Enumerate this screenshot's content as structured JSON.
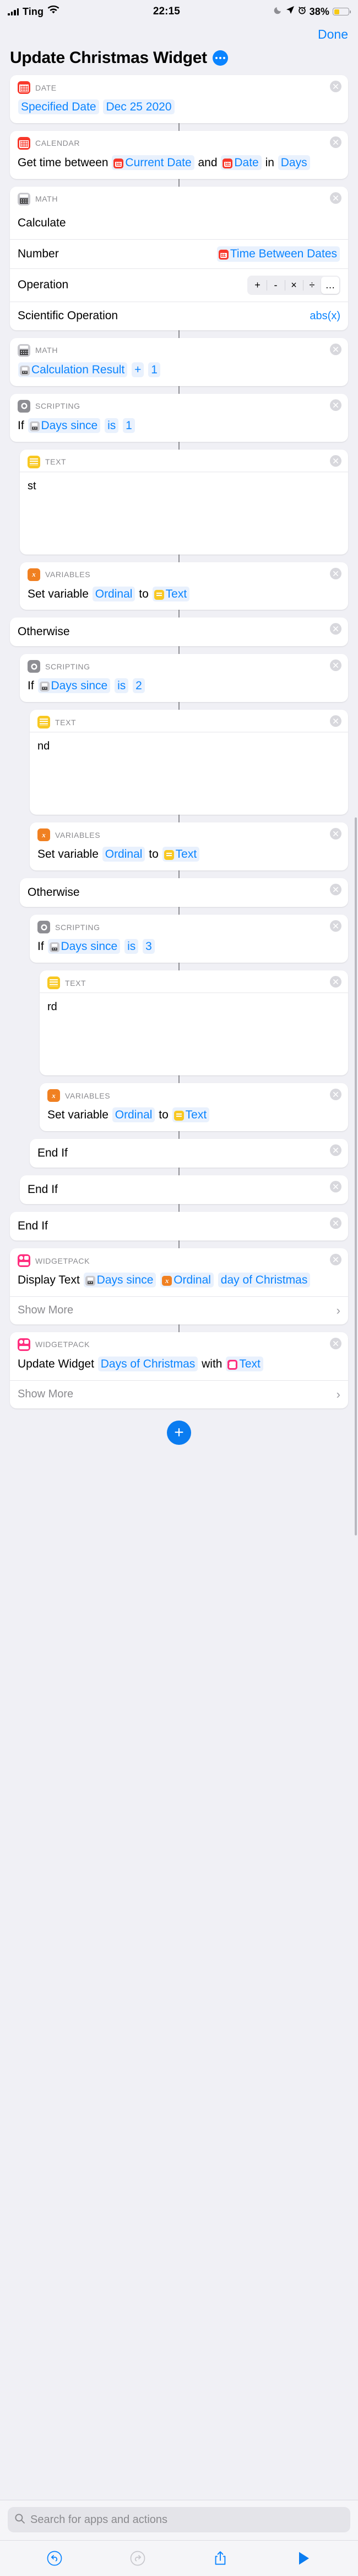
{
  "status_bar": {
    "carrier": "Ting",
    "time": "22:15",
    "battery_percent": "38%",
    "icons": [
      "signal-bars-icon",
      "wifi-icon",
      "moon-icon",
      "location-arrow-icon",
      "alarm-icon",
      "battery-icon"
    ]
  },
  "nav": {
    "done_label": "Done"
  },
  "header": {
    "title": "Update Christmas Widget",
    "more_label": "…"
  },
  "actions": [
    {
      "id": "date",
      "category": "DATE",
      "icon": "calendar-icon",
      "level": 0,
      "tokens": [
        {
          "t": "pill",
          "v": "Specified Date"
        },
        {
          "t": "pill",
          "v": "Dec 25 2020"
        }
      ]
    },
    {
      "id": "calendar",
      "category": "CALENDAR",
      "icon": "calendar-icon",
      "level": 0,
      "tokens": [
        {
          "t": "word",
          "v": "Get time between"
        },
        {
          "t": "pill-icon",
          "v": "Current Date",
          "icon": "calendar-icon"
        },
        {
          "t": "word",
          "v": "and"
        },
        {
          "t": "pill-icon",
          "v": "Date",
          "icon": "calendar-icon"
        },
        {
          "t": "word",
          "v": "in"
        },
        {
          "t": "pill",
          "v": "Days"
        }
      ]
    },
    {
      "id": "math-calculate",
      "category": "MATH",
      "icon": "calculator-icon",
      "level": 0,
      "heading": "Calculate",
      "rows": [
        {
          "label": "Number",
          "value": "Time Between Dates",
          "kind": "pill-icon",
          "icon": "calendar-icon"
        },
        {
          "label": "Operation",
          "kind": "segmented",
          "options": [
            "+",
            "-",
            "×",
            "÷",
            "…"
          ],
          "selected": 4
        },
        {
          "label": "Scientific Operation",
          "value": "abs(x)",
          "kind": "link"
        }
      ]
    },
    {
      "id": "math-plus-one",
      "category": "MATH",
      "icon": "calculator-icon",
      "level": 0,
      "tokens": [
        {
          "t": "pill-icon",
          "v": "Calculation Result",
          "icon": "calculator-icon"
        },
        {
          "t": "pill",
          "v": "+"
        },
        {
          "t": "pill",
          "v": "1"
        }
      ]
    },
    {
      "id": "if-1",
      "category": "SCRIPTING",
      "icon": "gear-icon",
      "level": 0,
      "tokens": [
        {
          "t": "word",
          "v": "If"
        },
        {
          "t": "pill-icon",
          "v": "Days since",
          "icon": "calculator-icon"
        },
        {
          "t": "pill",
          "v": "is"
        },
        {
          "t": "pill",
          "v": "1"
        }
      ]
    },
    {
      "id": "text-st",
      "category": "TEXT",
      "icon": "text-lines-icon",
      "level": 1,
      "textbody": "st"
    },
    {
      "id": "var-1",
      "category": "VARIABLES",
      "icon": "variable-x-icon",
      "level": 1,
      "tokens": [
        {
          "t": "word",
          "v": "Set variable"
        },
        {
          "t": "pill",
          "v": "Ordinal"
        },
        {
          "t": "word",
          "v": "to"
        },
        {
          "t": "pill-icon",
          "v": "Text",
          "icon": "text-lines-icon"
        }
      ]
    },
    {
      "id": "otherwise-1",
      "category": null,
      "level": 0,
      "plain": "Otherwise"
    },
    {
      "id": "if-2",
      "category": "SCRIPTING",
      "icon": "gear-icon",
      "level": 1,
      "tokens": [
        {
          "t": "word",
          "v": "If"
        },
        {
          "t": "pill-icon",
          "v": "Days since",
          "icon": "calculator-icon"
        },
        {
          "t": "pill",
          "v": "is"
        },
        {
          "t": "pill",
          "v": "2"
        }
      ]
    },
    {
      "id": "text-nd",
      "category": "TEXT",
      "icon": "text-lines-icon",
      "level": 2,
      "textbody": "nd"
    },
    {
      "id": "var-2",
      "category": "VARIABLES",
      "icon": "variable-x-icon",
      "level": 2,
      "tokens": [
        {
          "t": "word",
          "v": "Set variable"
        },
        {
          "t": "pill",
          "v": "Ordinal"
        },
        {
          "t": "word",
          "v": "to"
        },
        {
          "t": "pill-icon",
          "v": "Text",
          "icon": "text-lines-icon"
        }
      ]
    },
    {
      "id": "otherwise-2",
      "category": null,
      "level": 1,
      "plain": "Otherwise"
    },
    {
      "id": "if-3",
      "category": "SCRIPTING",
      "icon": "gear-icon",
      "level": 2,
      "tokens": [
        {
          "t": "word",
          "v": "If"
        },
        {
          "t": "pill-icon",
          "v": "Days since",
          "icon": "calculator-icon"
        },
        {
          "t": "pill",
          "v": "is"
        },
        {
          "t": "pill",
          "v": "3"
        }
      ]
    },
    {
      "id": "text-rd",
      "category": "TEXT",
      "icon": "text-lines-icon",
      "level": 3,
      "textbody": "rd"
    },
    {
      "id": "var-3",
      "category": "VARIABLES",
      "icon": "variable-x-icon",
      "level": 3,
      "tokens": [
        {
          "t": "word",
          "v": "Set variable"
        },
        {
          "t": "pill",
          "v": "Ordinal"
        },
        {
          "t": "word",
          "v": "to"
        },
        {
          "t": "pill-icon",
          "v": "Text",
          "icon": "text-lines-icon"
        }
      ]
    },
    {
      "id": "endif-1",
      "category": null,
      "level": 2,
      "plain": "End If"
    },
    {
      "id": "endif-2",
      "category": null,
      "level": 1,
      "plain": "End If"
    },
    {
      "id": "endif-3",
      "category": null,
      "level": 0,
      "plain": "End If"
    },
    {
      "id": "widget-display-text",
      "category": "WIDGETPACK",
      "icon": "widgetpack-icon",
      "level": 0,
      "tokens": [
        {
          "t": "word",
          "v": "Display Text"
        },
        {
          "t": "pill-icon",
          "v": "Days since",
          "icon": "calculator-icon"
        },
        {
          "t": "pill-icon",
          "v": "Ordinal",
          "icon": "variable-x-icon"
        },
        {
          "t": "pill",
          "v": "day of Christmas"
        }
      ],
      "show_more": "Show More"
    },
    {
      "id": "widget-update",
      "category": "WIDGETPACK",
      "icon": "widgetpack-icon",
      "level": 0,
      "tokens": [
        {
          "t": "word",
          "v": "Update Widget"
        },
        {
          "t": "pill",
          "v": "Days of Christmas"
        },
        {
          "t": "word",
          "v": "with"
        },
        {
          "t": "pill-icon",
          "v": "Text",
          "icon": "widgetpack-icon"
        }
      ],
      "show_more": "Show More"
    }
  ],
  "add_button": {
    "label": "+"
  },
  "search": {
    "placeholder": "Search for apps and actions",
    "icon": "search-icon"
  },
  "toolbar": {
    "undo": "undo-icon",
    "redo": "redo-icon",
    "share": "share-icon",
    "play": "play-icon"
  },
  "colors": {
    "accent": "#0a84ff",
    "background": "#f0f0f5",
    "pill_bg": "#e9f1fd",
    "date_icon": "#f8392c",
    "text_icon": "#f8c822",
    "variable_icon": "#f08021",
    "widget_icon": "#ff2e7e",
    "math_icon": "#c8c8cd",
    "script_icon": "#8e8e93",
    "battery_fill": "#f6c915"
  }
}
